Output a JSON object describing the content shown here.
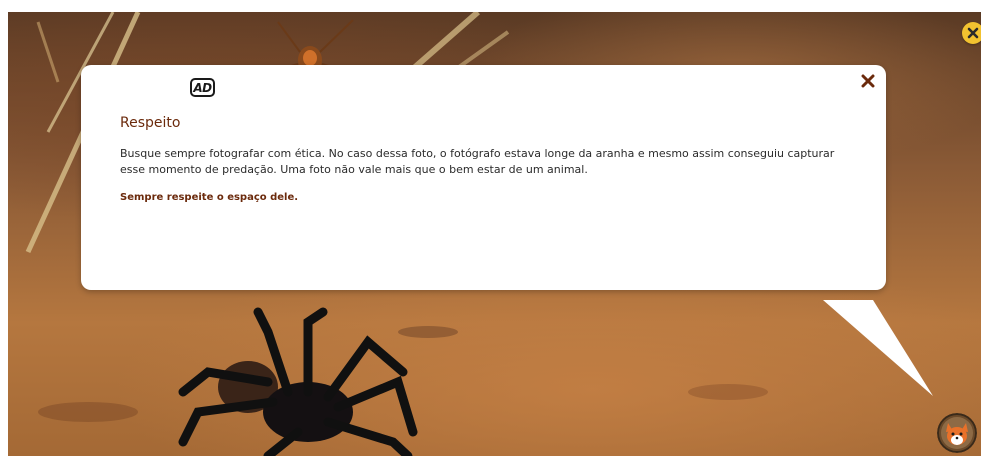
{
  "dialog": {
    "badge_text": "AD",
    "title": "Respeito",
    "body": "Busque sempre fotografar com ética. No caso dessa foto, o fotógrafo estava longe da aranha e mesmo assim conseguiu capturar esse momento de predação. Uma foto não vale mais que o bem estar de um animal.",
    "link_text": "Sempre respeite o espaço dele.",
    "close_icon": "close-icon"
  },
  "corner_close": {
    "icon": "close-icon",
    "color": "#f2c230"
  },
  "avatar": {
    "icon": "fox-mascot-icon"
  },
  "colors": {
    "accent": "#6b2a0c",
    "body_text": "#2b2b2b"
  }
}
